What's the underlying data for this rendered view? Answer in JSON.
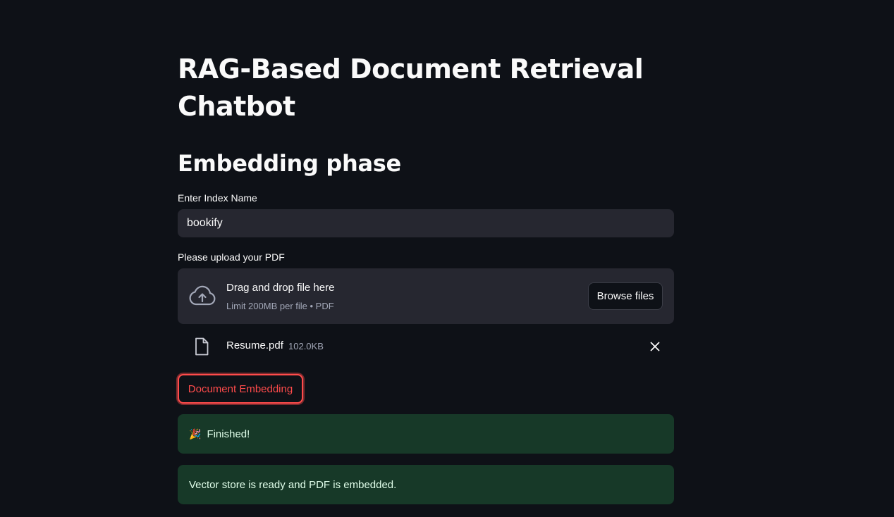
{
  "page": {
    "title": "RAG-Based Document Retrieval Chatbot",
    "section_title": "Embedding phase"
  },
  "index_field": {
    "label": "Enter Index Name",
    "value": "bookify"
  },
  "uploader": {
    "label": "Please upload your PDF",
    "drop_title": "Drag and drop file here",
    "drop_subtitle": "Limit 200MB per file • PDF",
    "browse_label": "Browse files",
    "icon": "cloud-upload-icon"
  },
  "uploaded_file": {
    "name": "Resume.pdf",
    "size": "102.0KB",
    "icon": "file-icon"
  },
  "actions": {
    "embed_label": "Document Embedding"
  },
  "alerts": [
    {
      "emoji": "🎉",
      "text": "Finished!"
    },
    {
      "text": "Vector store is ready and PDF is embedded."
    }
  ],
  "colors": {
    "background": "#0e1117",
    "accent": "#ff4b4b",
    "success_bg": "#173928",
    "input_bg": "#262730"
  }
}
